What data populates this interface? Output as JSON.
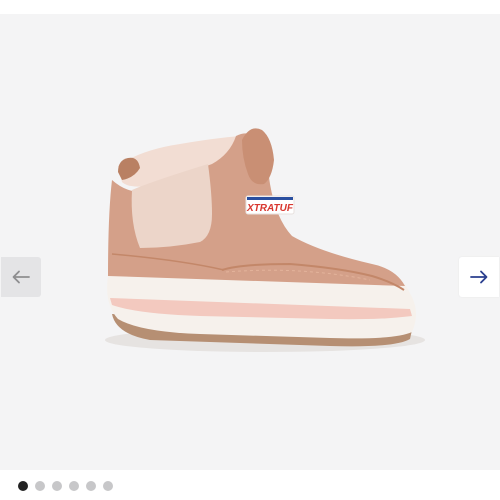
{
  "product": {
    "brand_label": "XTRATUF"
  },
  "navigation": {
    "prev_icon": "arrow-left-icon",
    "next_icon": "arrow-right-icon"
  },
  "pagination": {
    "total": 6,
    "active_index": 0
  },
  "colors": {
    "boot_upper": "#d4a089",
    "boot_lining": "#f2ddd3",
    "sole": "#f5efe9",
    "sole_stripe": "#f3c9bf",
    "accent_blue": "#2a4fa0",
    "accent_red": "#d8362e",
    "active_dot": "#222222",
    "inactive_dot": "#c7c7c9"
  }
}
